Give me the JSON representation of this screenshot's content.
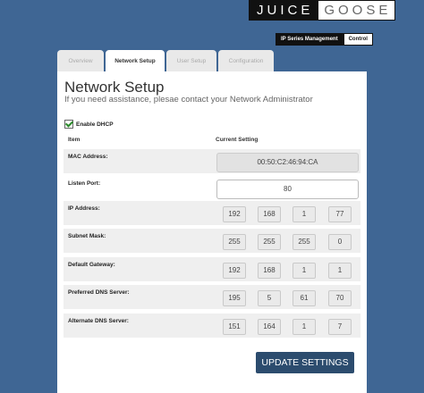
{
  "brand": {
    "part1": "JUICE",
    "part2": "GOOSE"
  },
  "top_buttons": [
    "IP Series Management",
    "Control"
  ],
  "tabs": [
    "Overview",
    "Network Setup",
    "User Setup",
    "Configuration"
  ],
  "active_tab": "Network Setup",
  "page": {
    "title": "Network Setup",
    "subtitle": "If you need assistance, plesae contact your Network Administrator"
  },
  "dhcp": {
    "label": "Enable DHCP",
    "checked": true
  },
  "table": {
    "col_item": "Item",
    "col_setting": "Current Setting"
  },
  "fields": {
    "mac": {
      "label": "MAC Address:",
      "value": "00:50:C2:46:94:CA"
    },
    "port": {
      "label": "Listen Port:",
      "value": "80"
    },
    "ip": {
      "label": "IP Address:",
      "octets": [
        "192",
        "168",
        "1",
        "77"
      ]
    },
    "mask": {
      "label": "Subnet Mask:",
      "octets": [
        "255",
        "255",
        "255",
        "0"
      ]
    },
    "gateway": {
      "label": "Default Gateway:",
      "octets": [
        "192",
        "168",
        "1",
        "1"
      ]
    },
    "dns1": {
      "label": "Preferred DNS Server:",
      "octets": [
        "195",
        "5",
        "61",
        "70"
      ]
    },
    "dns2": {
      "label": "Alternate DNS Server:",
      "octets": [
        "151",
        "164",
        "1",
        "7"
      ]
    }
  },
  "update_button": "UPDATE SETTINGS",
  "colors": {
    "background": "#3f6694",
    "button": "#2c4c6e"
  }
}
